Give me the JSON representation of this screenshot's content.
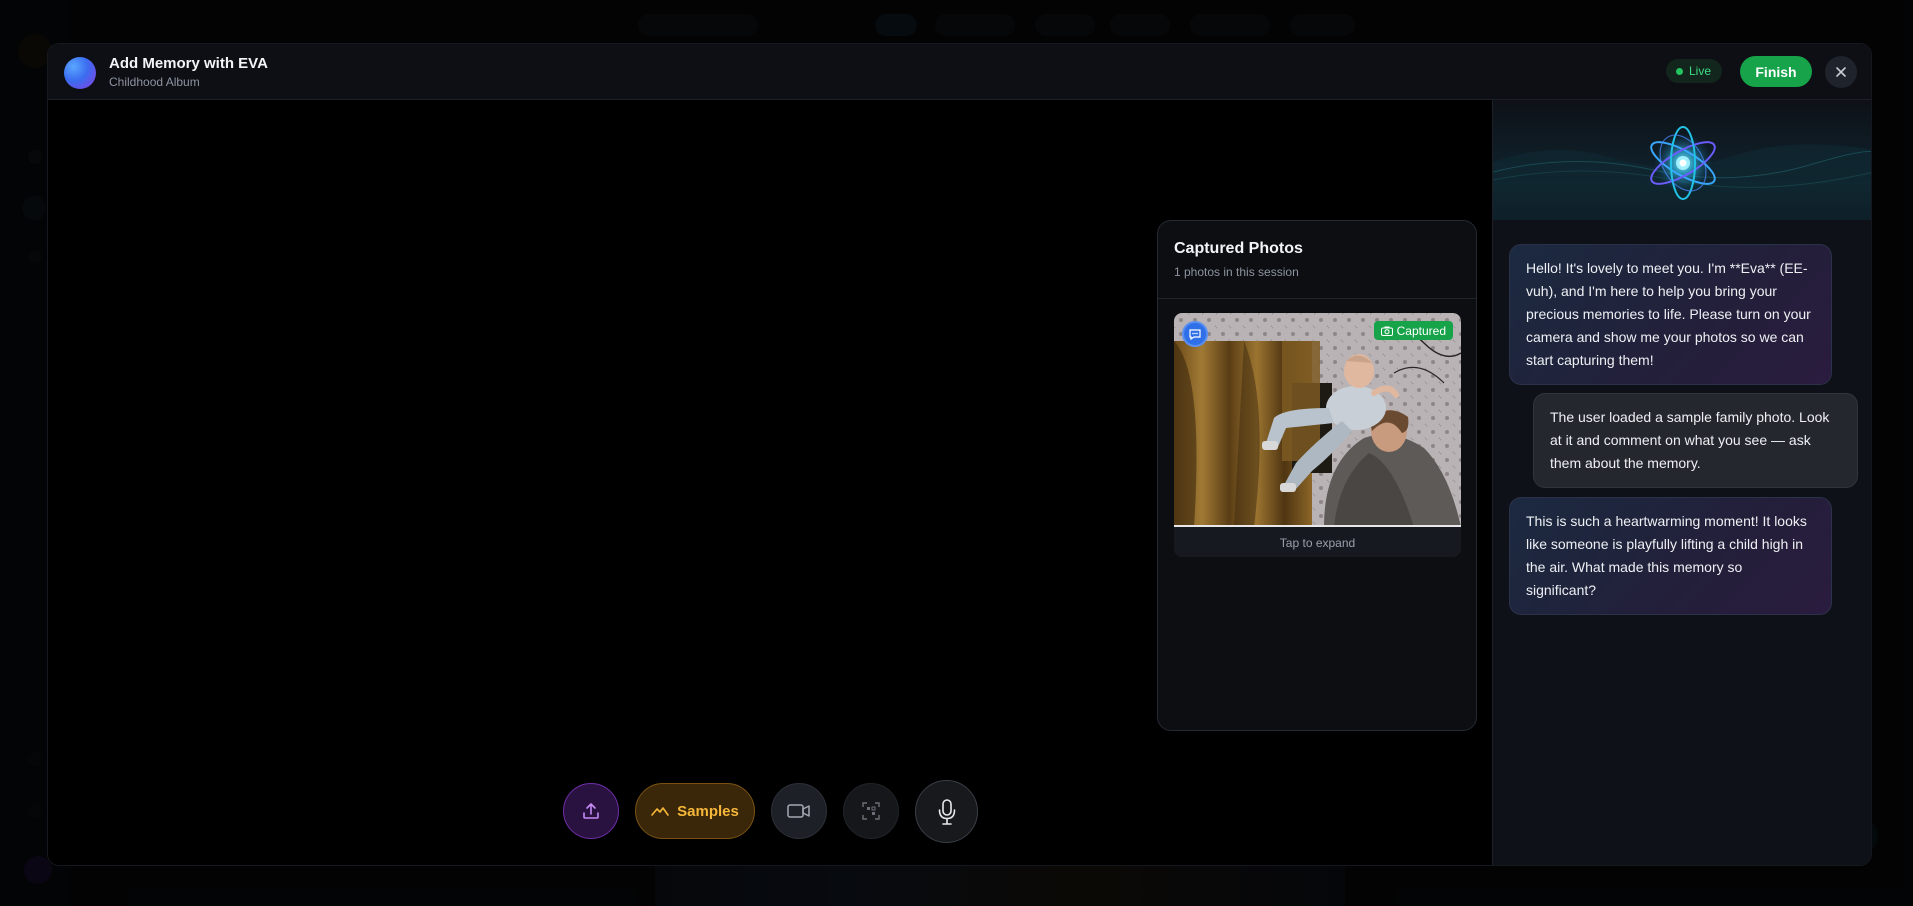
{
  "header": {
    "title": "Add Memory with EVA",
    "subtitle": "Childhood Album",
    "live_label": "Live",
    "finish_label": "Finish"
  },
  "photos_panel": {
    "title": "Captured Photos",
    "count_text": "1 photos in this session",
    "photos": [
      {
        "badge": "Captured",
        "expand_hint": "Tap to expand"
      }
    ]
  },
  "controls": {
    "samples_label": "Samples"
  },
  "chat": {
    "messages": [
      {
        "role": "eva",
        "text": "Hello! It's lovely to meet you. I'm **Eva** (EE-vuh), and I'm here to help you bring your precious memories to life. Please turn on your camera and show me your photos so we can start capturing them!"
      },
      {
        "role": "user",
        "text": "The user loaded a sample family photo. Look at it and comment on what you see — ask them about the memory."
      },
      {
        "role": "eva",
        "text": "This is such a heartwarming moment! It looks like someone is playfully lifting a child high in the air. What made this memory so significant?"
      }
    ]
  },
  "colors": {
    "accent_green": "#16a34a",
    "live_green": "#22c55e",
    "samples_amber": "#f5b73a",
    "upload_purple": "#6d2ea8"
  },
  "icons": {
    "upload": "upload-icon",
    "samples": "image-mountain-icon",
    "camera": "video-camera-icon",
    "scan": "scan-frame-icon",
    "mic": "microphone-icon",
    "close": "close-icon",
    "message": "message-bubble-icon",
    "captured": "camera-icon"
  }
}
